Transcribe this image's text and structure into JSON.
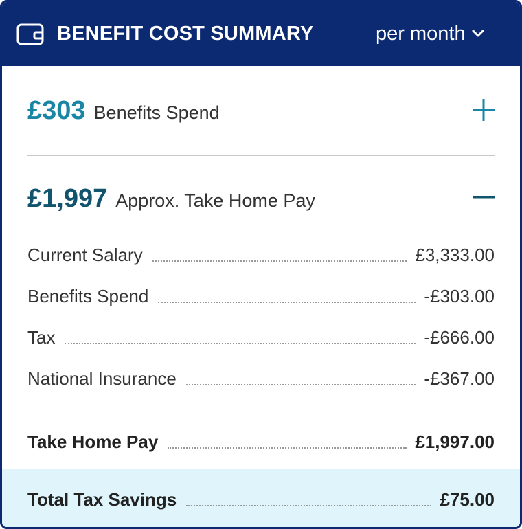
{
  "header": {
    "title": "BENEFIT COST SUMMARY",
    "period": "per month",
    "icon": "wallet-icon",
    "background": "#0b2a72"
  },
  "benefits": {
    "amount": "£303",
    "label": "Benefits Spend",
    "toggle_icon": "plus-icon",
    "expanded": false
  },
  "take_home": {
    "amount": "£1,997",
    "label": "Approx. Take Home Pay",
    "toggle_icon": "minus-icon",
    "expanded": true,
    "lines": [
      {
        "label": "Current Salary",
        "value": "£3,333.00"
      },
      {
        "label": "Benefits Spend",
        "value": "-£303.00"
      },
      {
        "label": "Tax",
        "value": "-£666.00"
      },
      {
        "label": "National Insurance",
        "value": "-£367.00"
      }
    ],
    "total": {
      "label": "Take Home Pay",
      "value": "£1,997.00"
    }
  },
  "savings": {
    "label": "Total Tax Savings",
    "value": "£75.00"
  },
  "colors": {
    "accent_teal": "#1a86a6",
    "accent_dark": "#12546e",
    "savings_bg": "#dff4fb"
  }
}
